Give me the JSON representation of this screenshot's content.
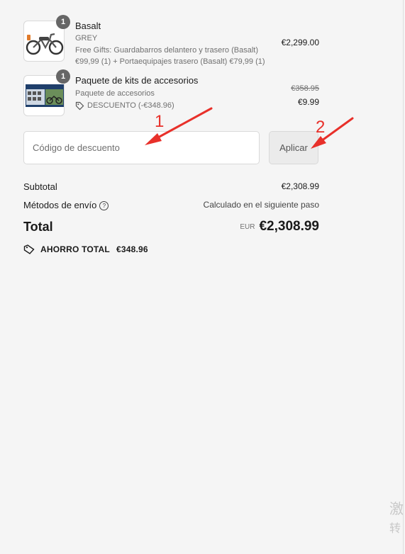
{
  "items": [
    {
      "quantity": "1",
      "name": "Basalt",
      "variant": "GREY",
      "extra_line1": "Free Gifts: Guardabarros delantero y trasero (Basalt)",
      "extra_line2": "€99,99 (1) + Portaequipajes trasero (Basalt) €79,99 (1)",
      "price": "€2,299.00"
    },
    {
      "quantity": "1",
      "name": "Paquete de kits de accesorios",
      "variant": "Paquete de accesorios",
      "discount": "DESCUENTO (-€348.96)",
      "original_price": "€358.95",
      "price": "€9.99"
    }
  ],
  "discount": {
    "placeholder": "Código de descuento",
    "value": "",
    "apply_label": "Aplicar"
  },
  "summary": {
    "subtotal_label": "Subtotal",
    "subtotal_value": "€2,308.99",
    "shipping_label": "Métodos de envío",
    "shipping_value": "Calculado en el siguiente paso",
    "total_label": "Total",
    "currency": "EUR",
    "total_value": "€2,308.99",
    "savings_label": "AHORRO TOTAL",
    "savings_value": "€348.96"
  },
  "annotations": {
    "one": "1",
    "two": "2",
    "color": "#e8302a"
  },
  "watermark": {
    "line1": "激",
    "line2": "转"
  },
  "icons": {
    "help": "question-circle-icon",
    "tag": "tag-icon",
    "bike": "e-bike-thumbnail",
    "kit": "accessory-kit-thumbnail"
  }
}
